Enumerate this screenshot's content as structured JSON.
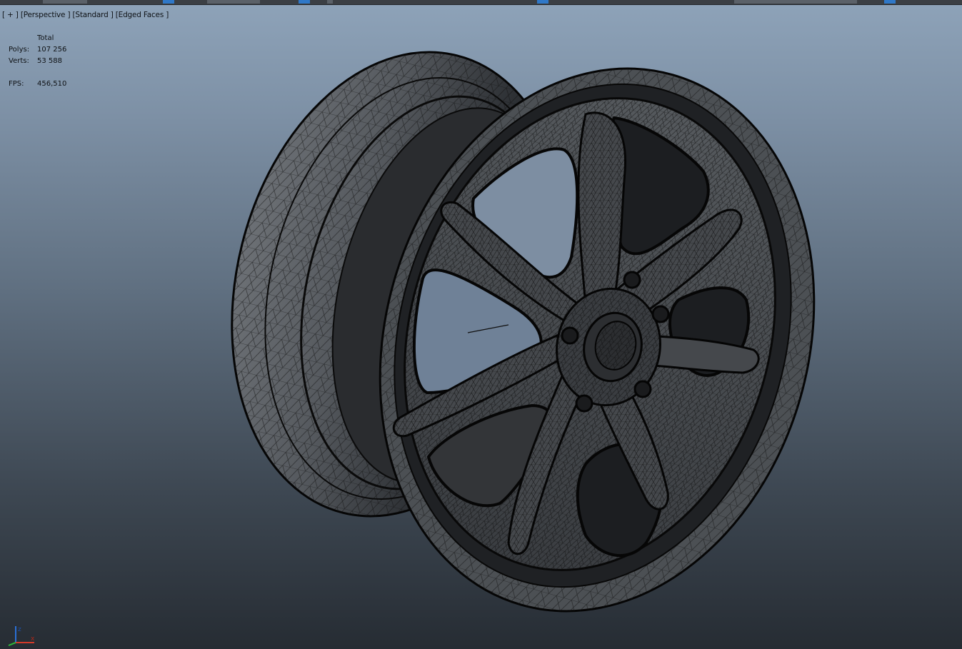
{
  "viewport": {
    "label_parts": [
      "[ + ]",
      "[Perspective ]",
      "[Standard ]",
      "[Edged Faces ]"
    ],
    "shading_mode": "Edged Faces"
  },
  "stats": {
    "header": "Total",
    "polys_label": "Polys:",
    "polys_value": "107 256",
    "verts_label": "Verts:",
    "verts_value": "53 588",
    "fps_label": "FPS:",
    "fps_value": "456,510"
  },
  "colors": {
    "viewport_top": "#8ea3b9",
    "viewport_bottom": "#262c33",
    "mesh_fill": "#4a4d51",
    "wire": "#0a0a0a",
    "ui_accent": "#2f78c8"
  },
  "icons": {
    "axis_gizmo": "xyz-axis-icon",
    "grid": "home-grid-icon"
  }
}
